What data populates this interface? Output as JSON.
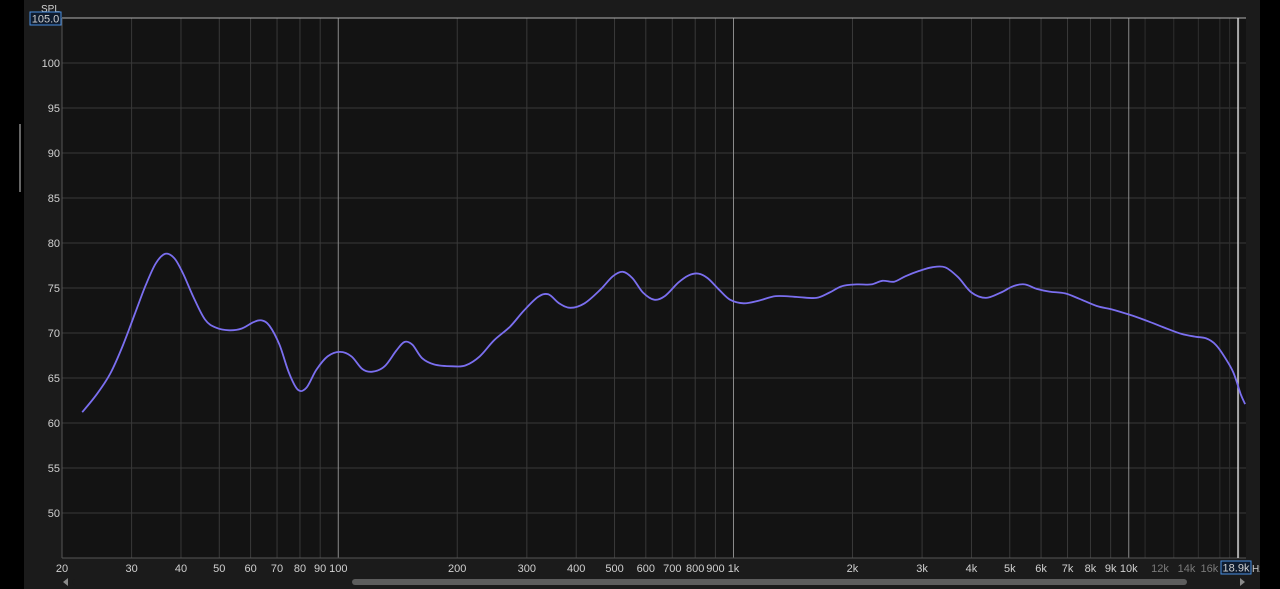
{
  "chart_data": {
    "type": "line",
    "xscale": "log",
    "xlim": [
      20,
      19800
    ],
    "ylim": [
      45,
      105
    ],
    "grid": true,
    "y_axis_label": "SPL",
    "x_axis_unit": "Hz",
    "y_max_box": "105.0",
    "x_max_box": "18.9k",
    "y_ticks": [
      50,
      55,
      60,
      65,
      70,
      75,
      80,
      85,
      90,
      95,
      100
    ],
    "x_ticks": [
      {
        "v": 20,
        "label": "20"
      },
      {
        "v": 30,
        "label": "30"
      },
      {
        "v": 40,
        "label": "40"
      },
      {
        "v": 50,
        "label": "50"
      },
      {
        "v": 60,
        "label": "60"
      },
      {
        "v": 70,
        "label": "70"
      },
      {
        "v": 80,
        "label": "80"
      },
      {
        "v": 90,
        "label": "90"
      },
      {
        "v": 100,
        "label": "100"
      },
      {
        "v": 200,
        "label": "200"
      },
      {
        "v": 300,
        "label": "300"
      },
      {
        "v": 400,
        "label": "400"
      },
      {
        "v": 500,
        "label": "500"
      },
      {
        "v": 600,
        "label": "600"
      },
      {
        "v": 700,
        "label": "700"
      },
      {
        "v": 800,
        "label": "800"
      },
      {
        "v": 900,
        "label": "900"
      },
      {
        "v": 1000,
        "label": "1k"
      },
      {
        "v": 2000,
        "label": "2k"
      },
      {
        "v": 3000,
        "label": "3k"
      },
      {
        "v": 4000,
        "label": "4k"
      },
      {
        "v": 5000,
        "label": "5k"
      },
      {
        "v": 6000,
        "label": "6k"
      },
      {
        "v": 7000,
        "label": "7k"
      },
      {
        "v": 8000,
        "label": "8k"
      },
      {
        "v": 9000,
        "label": "9k"
      },
      {
        "v": 10000,
        "label": "10k"
      },
      {
        "v": 12000,
        "label": "12k",
        "dim": true
      },
      {
        "v": 14000,
        "label": "14k",
        "dim": true
      },
      {
        "v": 16000,
        "label": "16k",
        "dim": true
      }
    ],
    "series": [
      {
        "color": "#7b6ff0",
        "points": [
          [
            22.5,
            61.2
          ],
          [
            24.5,
            63.2
          ],
          [
            26.5,
            65.5
          ],
          [
            28.5,
            68.6
          ],
          [
            30.5,
            72.0
          ],
          [
            32.5,
            75.2
          ],
          [
            34.5,
            77.7
          ],
          [
            36.5,
            78.8
          ],
          [
            38.5,
            78.3
          ],
          [
            40.5,
            76.6
          ],
          [
            43,
            74.0
          ],
          [
            46,
            71.5
          ],
          [
            49,
            70.6
          ],
          [
            53,
            70.3
          ],
          [
            57,
            70.5
          ],
          [
            61,
            71.2
          ],
          [
            64,
            71.4
          ],
          [
            67,
            70.8
          ],
          [
            71,
            68.7
          ],
          [
            75,
            65.6
          ],
          [
            79,
            63.7
          ],
          [
            83,
            63.9
          ],
          [
            88,
            65.9
          ],
          [
            94,
            67.4
          ],
          [
            101,
            67.9
          ],
          [
            108,
            67.4
          ],
          [
            115,
            66.0
          ],
          [
            122,
            65.7
          ],
          [
            131,
            66.3
          ],
          [
            140,
            68.0
          ],
          [
            147,
            69.0
          ],
          [
            154,
            68.7
          ],
          [
            163,
            67.2
          ],
          [
            175,
            66.5
          ],
          [
            195,
            66.3
          ],
          [
            210,
            66.4
          ],
          [
            228,
            67.4
          ],
          [
            248,
            69.2
          ],
          [
            272,
            70.7
          ],
          [
            295,
            72.5
          ],
          [
            320,
            74.0
          ],
          [
            340,
            74.3
          ],
          [
            362,
            73.3
          ],
          [
            387,
            72.8
          ],
          [
            420,
            73.3
          ],
          [
            460,
            74.8
          ],
          [
            495,
            76.3
          ],
          [
            525,
            76.8
          ],
          [
            555,
            76.1
          ],
          [
            590,
            74.5
          ],
          [
            630,
            73.7
          ],
          [
            670,
            74.1
          ],
          [
            725,
            75.6
          ],
          [
            770,
            76.4
          ],
          [
            815,
            76.6
          ],
          [
            860,
            76.1
          ],
          [
            920,
            74.8
          ],
          [
            980,
            73.7
          ],
          [
            1060,
            73.3
          ],
          [
            1160,
            73.6
          ],
          [
            1280,
            74.1
          ],
          [
            1450,
            74.0
          ],
          [
            1620,
            73.9
          ],
          [
            1750,
            74.5
          ],
          [
            1880,
            75.2
          ],
          [
            2050,
            75.4
          ],
          [
            2230,
            75.4
          ],
          [
            2380,
            75.8
          ],
          [
            2550,
            75.7
          ],
          [
            2720,
            76.3
          ],
          [
            2950,
            76.9
          ],
          [
            3180,
            77.3
          ],
          [
            3430,
            77.3
          ],
          [
            3700,
            76.2
          ],
          [
            4000,
            74.5
          ],
          [
            4350,
            73.9
          ],
          [
            4750,
            74.5
          ],
          [
            5100,
            75.2
          ],
          [
            5450,
            75.4
          ],
          [
            5850,
            74.9
          ],
          [
            6300,
            74.6
          ],
          [
            6900,
            74.4
          ],
          [
            7500,
            73.8
          ],
          [
            8300,
            73.0
          ],
          [
            9100,
            72.6
          ],
          [
            10100,
            72.0
          ],
          [
            11200,
            71.3
          ],
          [
            12300,
            70.6
          ],
          [
            13600,
            69.9
          ],
          [
            14700,
            69.6
          ],
          [
            15700,
            69.4
          ],
          [
            16600,
            68.7
          ],
          [
            17500,
            67.3
          ],
          [
            18400,
            65.6
          ],
          [
            19200,
            63.2
          ],
          [
            19700,
            62.1
          ]
        ]
      }
    ]
  }
}
